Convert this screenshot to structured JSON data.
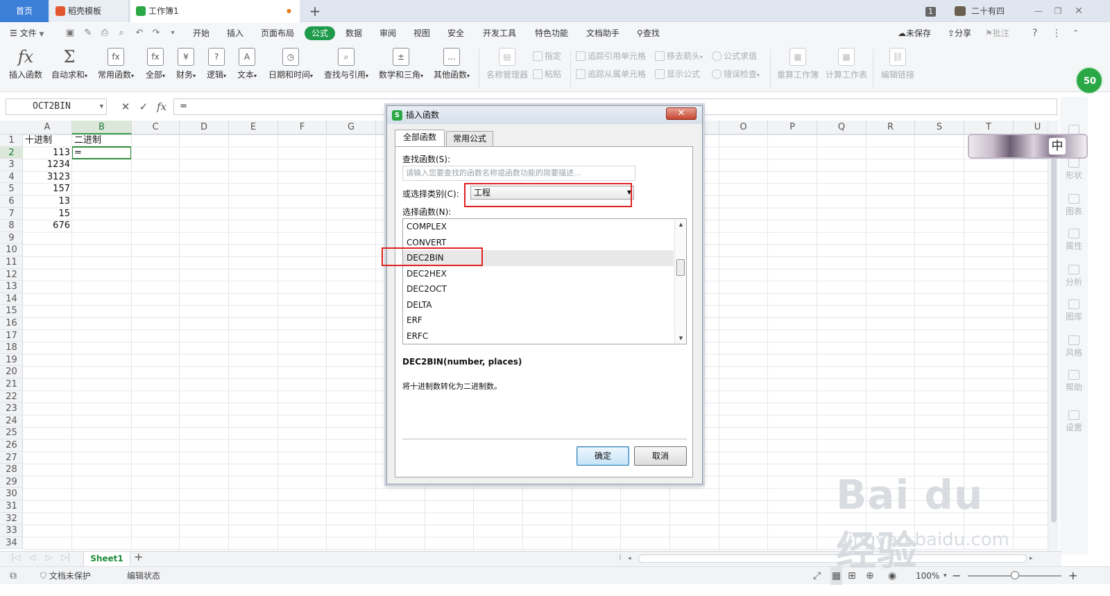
{
  "tabs": {
    "home": "首页",
    "template": "稻壳模板",
    "workbook": "工作簿1",
    "unsaved_dot": "●",
    "new_tab": "+"
  },
  "window": {
    "badge_count": "1",
    "user_name": "二十有四"
  },
  "menu": {
    "file": "文件",
    "items": [
      "开始",
      "插入",
      "页面布局",
      "公式",
      "数据",
      "审阅",
      "视图",
      "安全",
      "开发工具",
      "特色功能",
      "文档助手"
    ],
    "active": "公式",
    "search": "查找",
    "unsaved": "未保存",
    "share": "分享",
    "comment": "批注"
  },
  "ribbon": {
    "insert_function": "插入函数",
    "autosum": "自动求和",
    "common_functions": "常用函数",
    "all": "全部",
    "finance": "财务",
    "logic": "逻辑",
    "text": "文本",
    "datetime": "日期和时间",
    "lookup": "查找与引用",
    "math": "数学和三角",
    "other": "其他函数",
    "name_manager": "名称管理器",
    "define": "指定",
    "paste": "粘贴",
    "trace_precedents": "追踪引用单元格",
    "trace_dependents": "追踪从属单元格",
    "remove_arrows": "移去箭头",
    "show_formula": "显示公式",
    "evaluate": "公式求值",
    "error_check": "错误检查",
    "recalc_workbook": "重算工作簿",
    "calc_sheet": "计算工作表",
    "edit_links": "编辑链接",
    "badge": "50"
  },
  "formula_bar": {
    "name_box": "OCT2BIN",
    "cancel": "✕",
    "confirm": "✓",
    "fx": "fx",
    "content": "="
  },
  "grid": {
    "columns": [
      "A",
      "B",
      "C",
      "D",
      "E",
      "F",
      "G",
      "H",
      "I",
      "J",
      "K",
      "L",
      "M",
      "N",
      "O",
      "P",
      "Q",
      "R",
      "S",
      "T",
      "U"
    ],
    "rows": [
      "1",
      "2",
      "3",
      "4",
      "5",
      "6",
      "7",
      "8",
      "9",
      "10",
      "11",
      "12",
      "13",
      "14",
      "15",
      "16",
      "17",
      "18",
      "19",
      "20",
      "21",
      "22",
      "23",
      "24",
      "25",
      "26",
      "27",
      "28",
      "29",
      "30",
      "31",
      "32",
      "33",
      "34"
    ],
    "header_a": "十进制",
    "header_b": "二进制",
    "values_a": [
      "113",
      "1234",
      "3123",
      "157",
      "13",
      "15",
      "676"
    ],
    "b2": "="
  },
  "side_panel": [
    "选择",
    "形状",
    "图表",
    "属性",
    "分析",
    "图库",
    "风格",
    "帮助",
    "设置"
  ],
  "ime": "中",
  "sheet": {
    "name": "Sheet1",
    "add": "+"
  },
  "status": {
    "protect": "文档未保护",
    "mode": "编辑状态",
    "zoom": "100%",
    "minus": "−",
    "plus": "+"
  },
  "dialog": {
    "title": "插入函数",
    "close": "✕",
    "tab_all": "全部函数",
    "tab_common": "常用公式",
    "search_label": "查找函数(S):",
    "search_placeholder": "请输入您要查找的函数名称或函数功能的简要描述...",
    "category_label": "或选择类别(C):",
    "category_value": "工程",
    "list_label": "选择函数(N):",
    "functions": [
      "COMPLEX",
      "CONVERT",
      "DEC2BIN",
      "DEC2HEX",
      "DEC2OCT",
      "DELTA",
      "ERF",
      "ERFC"
    ],
    "selected_function": "DEC2BIN",
    "signature": "DEC2BIN(number, places)",
    "description": "将十进制数转化为二进制数。",
    "ok": "确定",
    "cancel": "取消"
  },
  "watermark": {
    "main": "Bai du 经验",
    "url": "jingyan.baidu.com"
  },
  "colors": {
    "accent_green": "#1f9b4c",
    "home_tab_blue": "#3c7fd8",
    "highlight_red": "#e02020"
  }
}
